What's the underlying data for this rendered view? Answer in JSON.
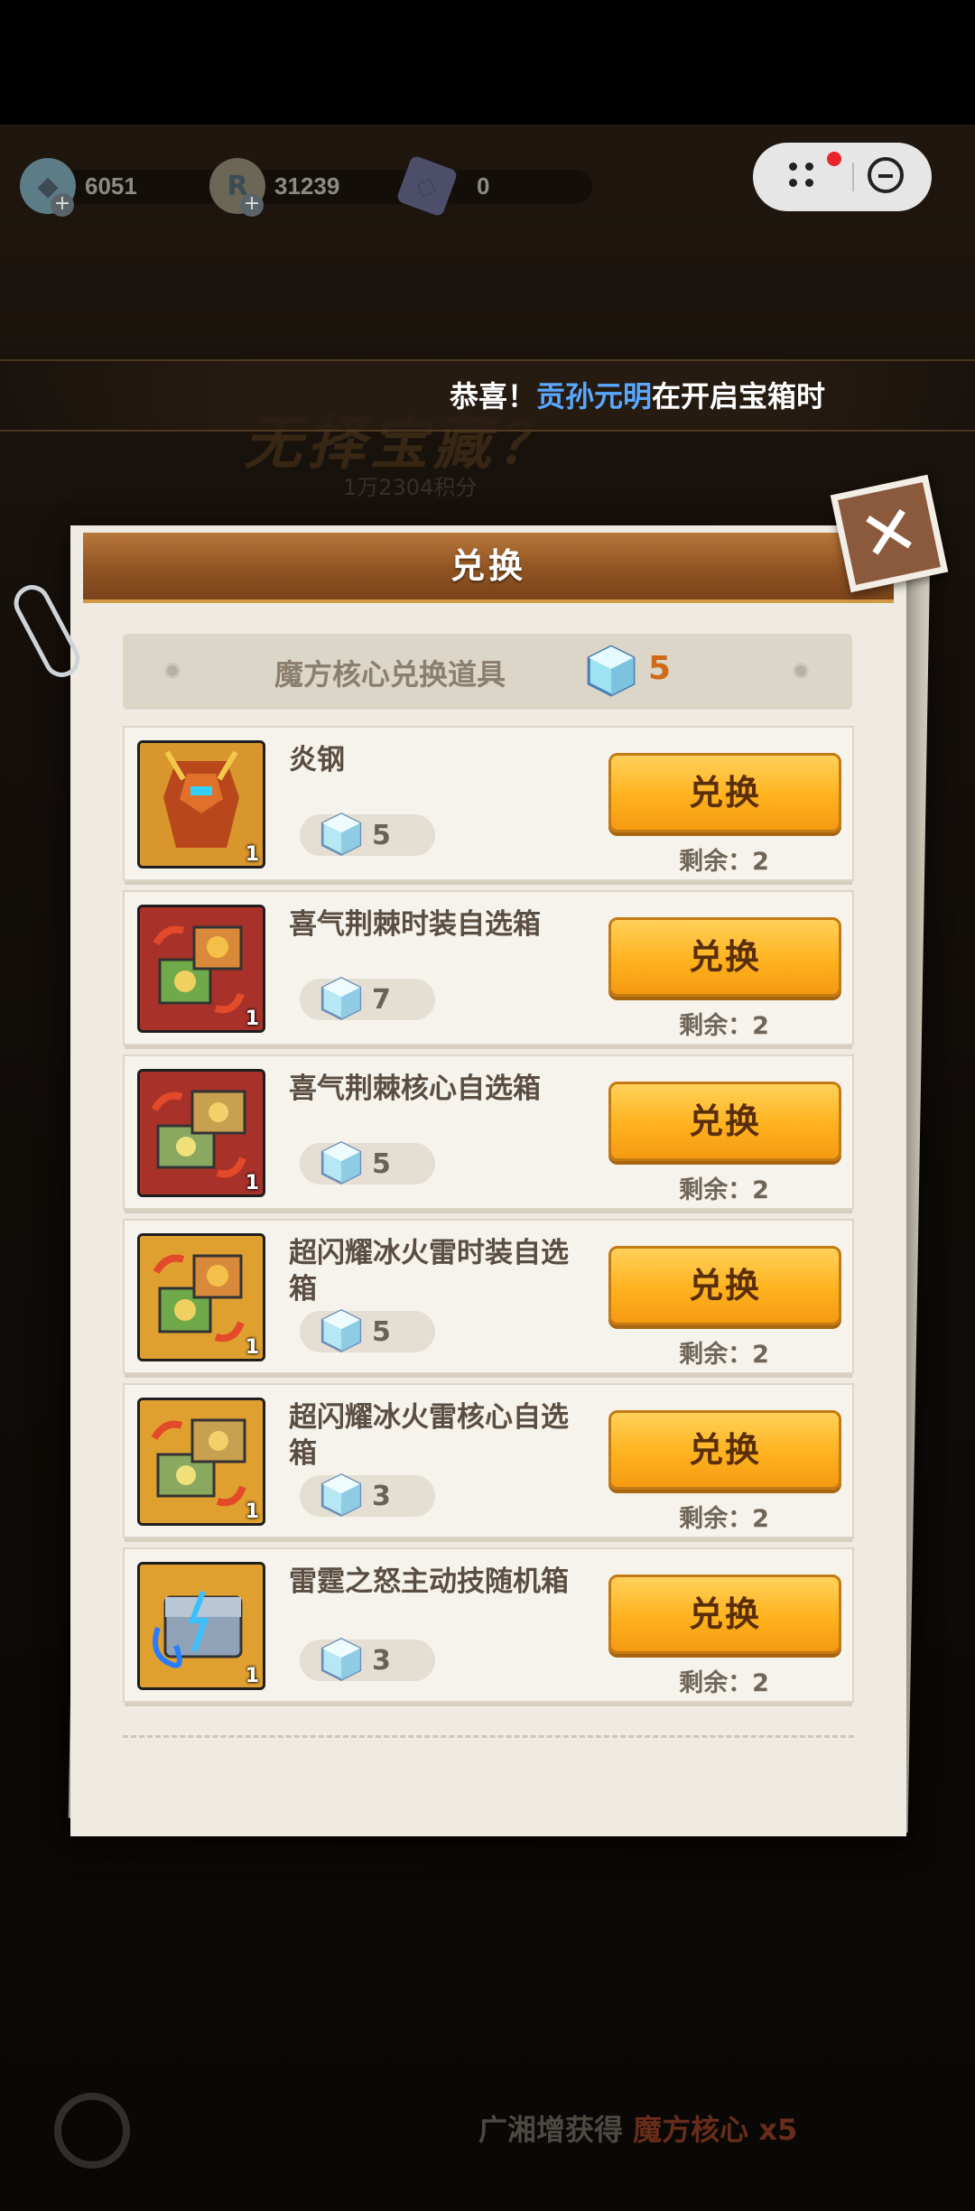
{
  "resources": [
    {
      "icon": "blue-crystal-icon",
      "value": "6051"
    },
    {
      "icon": "gold-coin-icon",
      "value": "31239"
    },
    {
      "icon": "ticket-card-icon",
      "value": "0"
    }
  ],
  "announcement": {
    "prefix": "恭喜！",
    "player": "贡孙元明",
    "suffix": "在开启宝箱时"
  },
  "background": {
    "title": "无择宝藏？",
    "subtitle": "1万2304积分"
  },
  "dialog": {
    "title": "兑换",
    "section_title": "魔方核心兑换道具",
    "owned": "5",
    "items": [
      {
        "name": "炎钢",
        "cost": "5",
        "qty": "1",
        "button": "兑换",
        "remain_label": "剩余：",
        "remain": "2",
        "icon": "mech-warrior-icon"
      },
      {
        "name": "喜气荆棘时装自选箱",
        "cost": "7",
        "qty": "1",
        "button": "兑换",
        "remain_label": "剩余：",
        "remain": "2",
        "icon": "costume-chest-icon"
      },
      {
        "name": "喜气荆棘核心自选箱",
        "cost": "5",
        "qty": "1",
        "button": "兑换",
        "remain_label": "剩余：",
        "remain": "2",
        "icon": "core-chest-icon"
      },
      {
        "name": "超闪耀冰火雷时装自选箱",
        "cost": "5",
        "qty": "1",
        "button": "兑换",
        "remain_label": "剩余：",
        "remain": "2",
        "icon": "costume-chest-icon"
      },
      {
        "name": "超闪耀冰火雷核心自选箱",
        "cost": "3",
        "qty": "1",
        "button": "兑换",
        "remain_label": "剩余：",
        "remain": "2",
        "icon": "core-chest-icon"
      },
      {
        "name": "雷霆之怒主动技随机箱",
        "cost": "3",
        "qty": "1",
        "button": "兑换",
        "remain_label": "剩余：",
        "remain": "2",
        "icon": "thunder-chest-icon"
      }
    ]
  },
  "bottom": {
    "text": "广湘增获得",
    "highlight": "魔方核心",
    "count": "x5"
  }
}
